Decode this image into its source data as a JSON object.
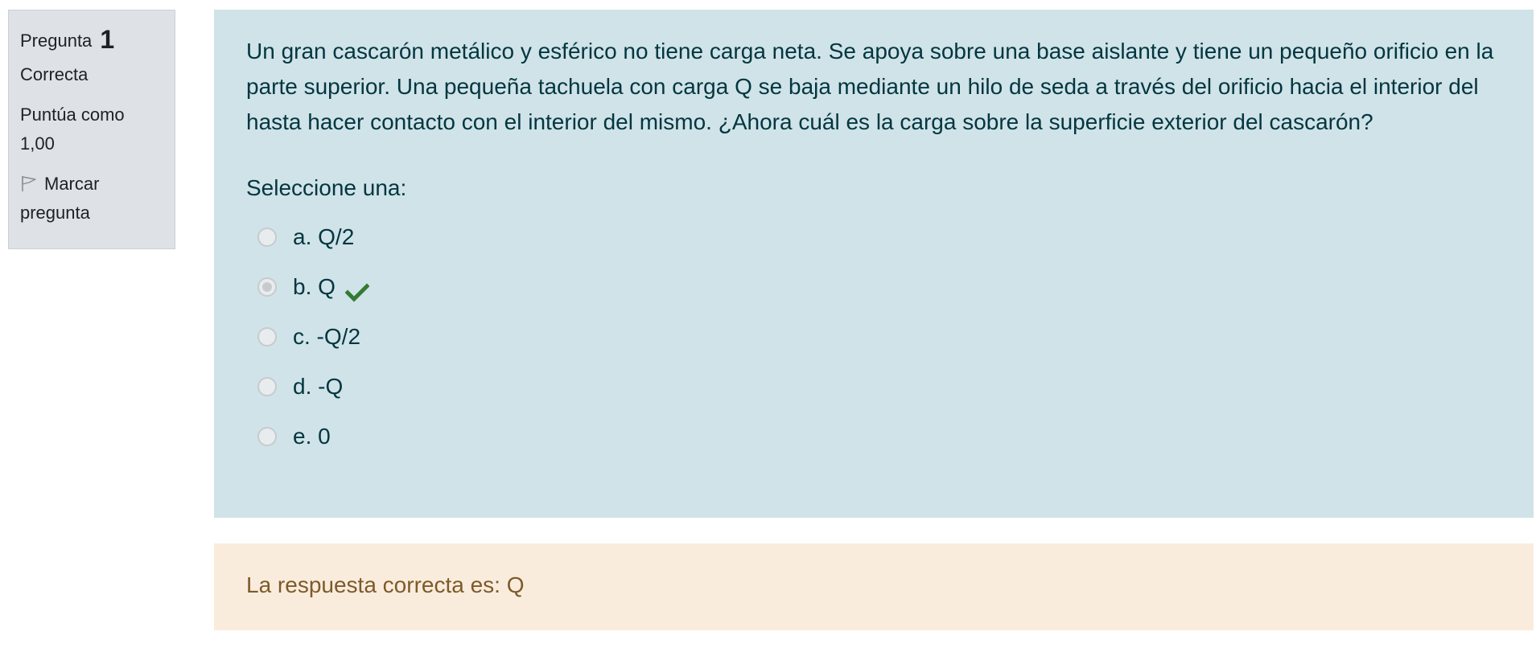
{
  "info": {
    "question_label": "Pregunta",
    "question_number": "1",
    "state": "Correcta",
    "grade_label": "Puntúa como",
    "grade_value": "1,00",
    "flag_label_line1": "Marcar",
    "flag_label_line2": "pregunta",
    "flag_icon": "flag-icon"
  },
  "question": {
    "text": "Un gran cascarón metálico y esférico no tiene carga neta. Se apoya sobre una base aislante y tiene un pequeño orificio en la parte superior. Una pequeña tachuela con carga Q se baja mediante un hilo de seda a través del orificio hacia el interior del hasta hacer contacto con el interior del mismo. ¿Ahora cuál es la carga sobre la superficie exterior del cascarón?",
    "prompt": "Seleccione una:",
    "answers": [
      {
        "label": "a. Q/2",
        "selected": false,
        "correct": false
      },
      {
        "label": "b. Q",
        "selected": true,
        "correct": true
      },
      {
        "label": "c. -Q/2",
        "selected": false,
        "correct": false
      },
      {
        "label": "d. -Q",
        "selected": false,
        "correct": false
      },
      {
        "label": "e. 0",
        "selected": false,
        "correct": false
      }
    ]
  },
  "feedback": {
    "right_answer": "La respuesta correcta es: Q"
  },
  "colors": {
    "info_bg": "#dee2e6",
    "formulation_bg": "#d0e3e8",
    "formulation_text": "#023640",
    "feedback_bg": "#faecdd",
    "feedback_text": "#7d5a29",
    "correct_check": "#357a32"
  }
}
